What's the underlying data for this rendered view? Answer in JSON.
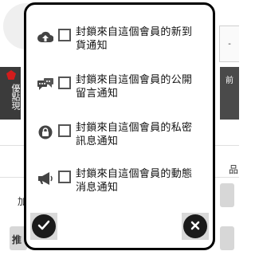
{
  "background": {
    "left_tab_text": "優點現",
    "right_tab_text": "前",
    "right_top_text": "-",
    "side_char_1": "品",
    "side_char_2": "加",
    "side_char_3": "推"
  },
  "modal": {
    "options": [
      {
        "icon": "upload-cloud-icon",
        "label": "封鎖來自這個會員的新到貨通知",
        "checked": false
      },
      {
        "icon": "chat-bubbles-icon",
        "label": "封鎖來自這個會員的公開留言通知",
        "checked": false
      },
      {
        "icon": "lock-icon",
        "label": "封鎖來自這個會員的私密訊息通知",
        "checked": false
      },
      {
        "icon": "megaphone-icon",
        "label": "封鎖來自這個會員的動態消息通知",
        "checked": false
      }
    ],
    "confirm_icon": "checkmark-icon",
    "cancel_icon": "close-icon"
  }
}
